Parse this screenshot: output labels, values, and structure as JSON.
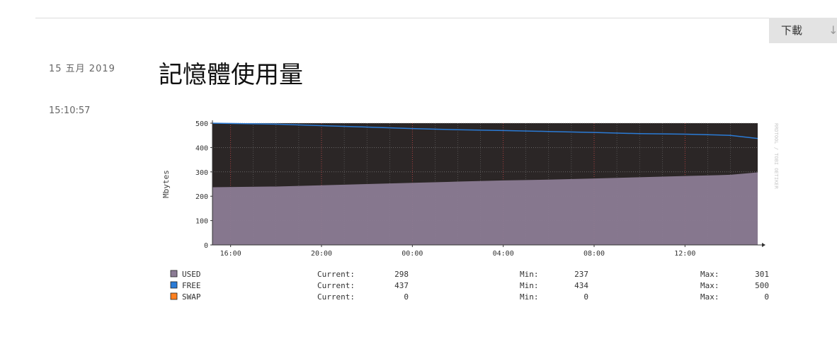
{
  "download_label": "下載",
  "download_icon": "arrow-down-icon",
  "date": "15 五月 2019",
  "time": "15:10:57",
  "title": "記憶體使用量",
  "chart_data": {
    "type": "area",
    "ylabel": "Mbytes",
    "ylim": [
      0,
      500
    ],
    "y_ticks": [
      "0",
      "100",
      "200",
      "300",
      "400",
      "500"
    ],
    "x_ticks": [
      "16:00",
      "20:00",
      "00:00",
      "04:00",
      "08:00",
      "12:00"
    ],
    "x_tick_hours": [
      16,
      20,
      24,
      28,
      32,
      36
    ],
    "x_range_hours": [
      15.2,
      39.2
    ],
    "watermark": "RRDTOOL / TOBI OETIKER",
    "grid": true,
    "colors": {
      "USED": "#8b7b94",
      "FREE": "#2b7bd6",
      "SWAP": "#ff8020",
      "background": "#2b2626",
      "grid": "#c04040"
    },
    "series": [
      {
        "name": "USED",
        "x_hours": [
          15.2,
          18,
          20,
          22,
          24,
          26,
          28,
          30,
          32,
          34,
          36,
          38,
          39.2
        ],
        "values": [
          237,
          240,
          245,
          250,
          255,
          260,
          265,
          268,
          273,
          278,
          283,
          288,
          298
        ],
        "current": "298",
        "min": "237",
        "max": "301"
      },
      {
        "name": "FREE",
        "x_hours": [
          15.2,
          18,
          20,
          22,
          24,
          26,
          28,
          30,
          32,
          34,
          36,
          38,
          39.2
        ],
        "values": [
          500,
          496,
          490,
          484,
          478,
          473,
          470,
          466,
          462,
          457,
          455,
          450,
          437
        ],
        "current": "437",
        "min": "434",
        "max": "500"
      },
      {
        "name": "SWAP",
        "x_hours": [
          15.2,
          39.2
        ],
        "values": [
          0,
          0
        ],
        "current": "0",
        "min": "0",
        "max": "0"
      }
    ],
    "legend_labels": {
      "current": "Current:",
      "min": "Min:",
      "max": "Max:"
    }
  }
}
